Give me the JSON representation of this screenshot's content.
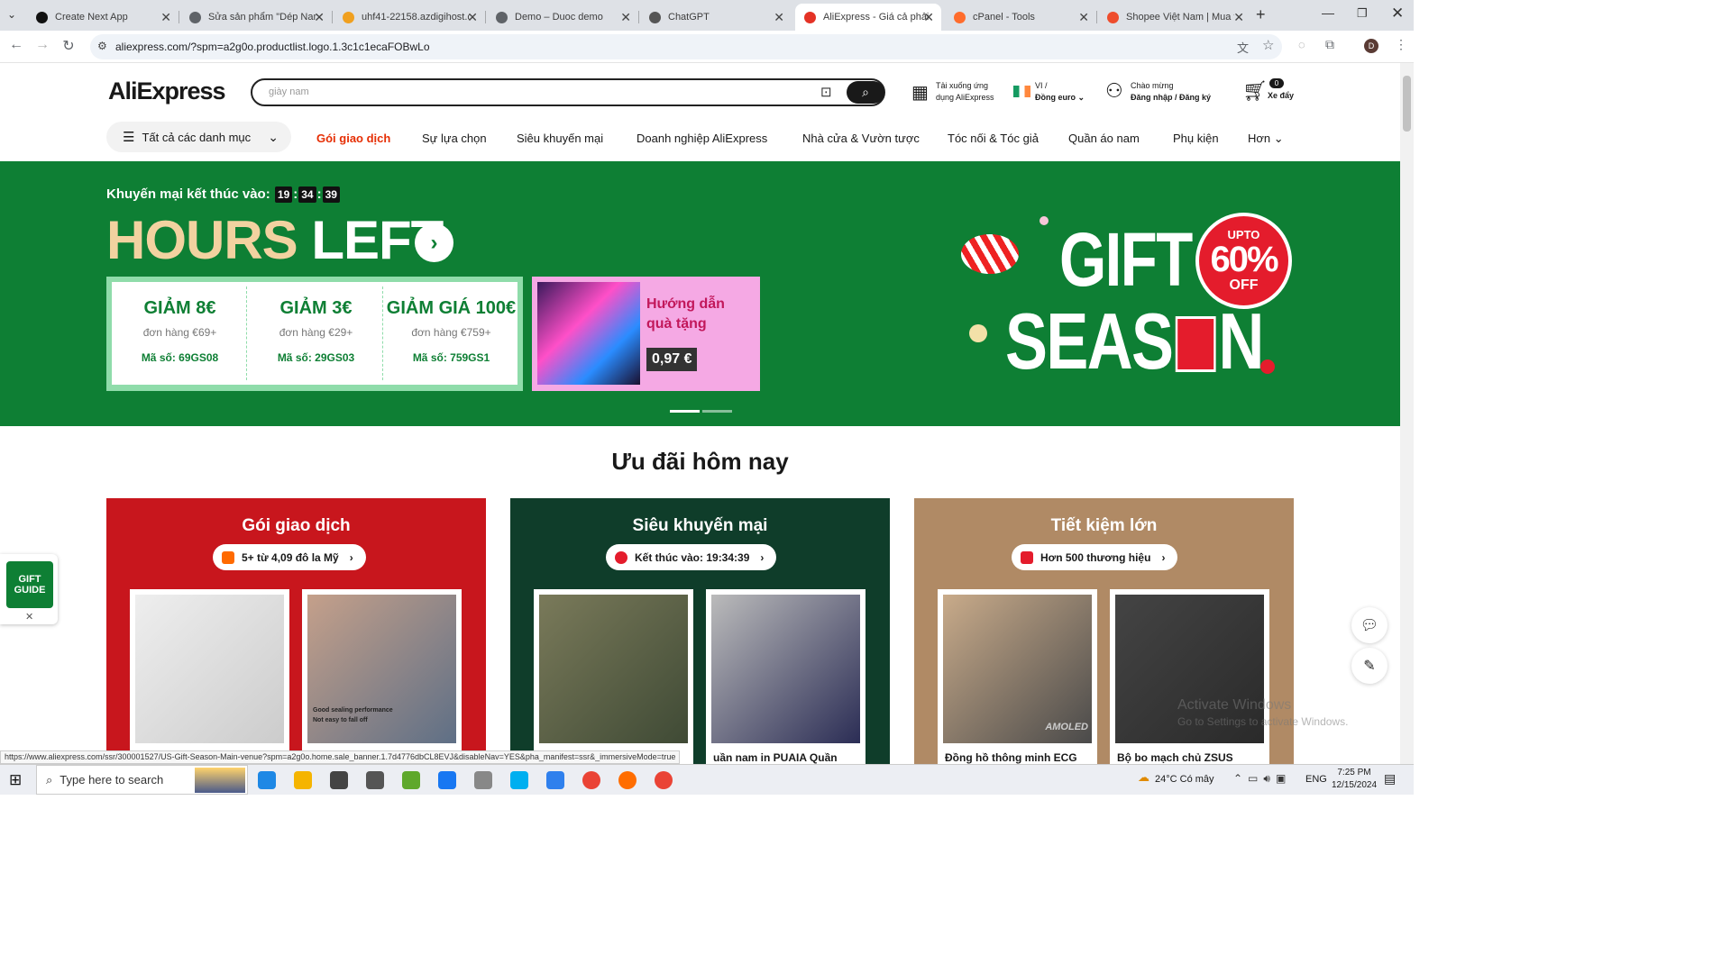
{
  "browser": {
    "tabs": [
      {
        "title": "Create Next App",
        "favicon": "nextjs-icon",
        "color": "#111111"
      },
      {
        "title": "Sửa sản phẩm \"Dép Nam",
        "favicon": "globe-icon",
        "color": "#5f6368"
      },
      {
        "title": "uhf41-22158.azdigihost.cc",
        "favicon": "host-icon",
        "color": "#f0a020"
      },
      {
        "title": "Demo – Duoc demo",
        "favicon": "globe-icon",
        "color": "#5f6368"
      },
      {
        "title": "ChatGPT",
        "favicon": "chatgpt-icon",
        "color": "#555555"
      },
      {
        "title": "AliExpress - Giá cả phải ch",
        "favicon": "aliexpress-icon",
        "color": "#e43225",
        "active": true
      },
      {
        "title": "cPanel - Tools",
        "favicon": "cpanel-icon",
        "color": "#ff6c2c"
      },
      {
        "title": "Shopee Việt Nam | Mua v",
        "favicon": "shopee-icon",
        "color": "#ee4d2d"
      }
    ],
    "url": "aliexpress.com/?spm=a2g0o.productlist.logo.1.3c1c1ecaFOBwLo",
    "profile_initial": "D",
    "status_url": "https://www.aliexpress.com/ssr/300001527/US-Gift-Season-Main-venue?spm=a2g0o.home.sale_banner.1.7d4776dbCL8EVJ&disableNav=YES&pha_manifest=ssr&_immersiveMode=true"
  },
  "header": {
    "logo": "AliExpress",
    "search_placeholder": "giày nam",
    "app_download_line1": "Tải xuống ứng",
    "app_download_line2": "dụng AliExpress",
    "lang_line1": "VI /",
    "lang_line2": "Đồng euro",
    "welcome_line1": "Chào mừng",
    "welcome_line2": "Đăng nhập / Đăng ký",
    "cart_count": "0",
    "cart_label": "Xe đẩy"
  },
  "nav": {
    "all_categories": "Tất cả các danh mục",
    "items": [
      "Gói giao dịch",
      "Sự lựa chọn",
      "Siêu khuyến mại",
      "Doanh nghiệp AliExpress",
      "Nhà cửa & Vườn tược",
      "Tóc nối & Tóc giả",
      "Quần áo nam",
      "Phụ kiện"
    ],
    "more": "Hơn"
  },
  "banner": {
    "promo_ends": "Khuyến mại kết thúc vào:",
    "timer": [
      "19",
      "34",
      "39"
    ],
    "headline_part1": "HOURS",
    "headline_part2": "LEFT",
    "coupons": [
      {
        "title": "GIẢM 8€",
        "min": "đơn hàng €69+",
        "code": "Mã số: 69GS08"
      },
      {
        "title": "GIẢM 3€",
        "min": "đơn hàng €29+",
        "code": "Mã số: 29GS03"
      },
      {
        "title": "GIẢM GIÁ 100€",
        "min": "đơn hàng €759+",
        "code": "Mã số: 759GS1"
      }
    ],
    "gift_guide_title": "Hướng dẫn quà tặng",
    "gift_guide_price": "0,97 €",
    "gift_text_line1": "GIFT",
    "gift_text_line2a": "SEAS",
    "gift_text_line2b": "N",
    "upto": "UPTO",
    "percent": "60%",
    "off": "OFF"
  },
  "deals": {
    "heading": "Ưu đãi hôm nay",
    "cards": [
      {
        "title": "Gói giao dịch",
        "pill": "5+ từ 4,09 đô la Mỹ",
        "bg": "#c8161d",
        "products": [
          "",
          ""
        ]
      },
      {
        "title": "Siêu khuyến mại",
        "pill": "Kết thúc vào: 19:34:39",
        "bg": "#0f3d2a",
        "products": [
          "",
          "uần nam in PUAIA Quần"
        ]
      },
      {
        "title": "Tiết kiệm lớn",
        "pill": "Hơn 500 thương hiệu",
        "bg": "#b08a65",
        "products": [
          "Đồng hồ thông minh ECG",
          "Bộ bo mạch chủ ZSUS"
        ]
      }
    ],
    "product_overlay_text": [
      "Good sealing performance",
      "Not easy to fall off"
    ],
    "amoled_badge": "AMOLED"
  },
  "gift_widget": {
    "line1": "GIFT",
    "line2": "GUIDE"
  },
  "watermark": {
    "line1": "Activate Windows",
    "line2": "Go to Settings to activate Windows."
  },
  "taskbar": {
    "search_placeholder": "Type here to search",
    "weather": "24°C  Có mây",
    "lang": "ENG",
    "time": "7:25 PM",
    "date": "12/15/2024"
  }
}
